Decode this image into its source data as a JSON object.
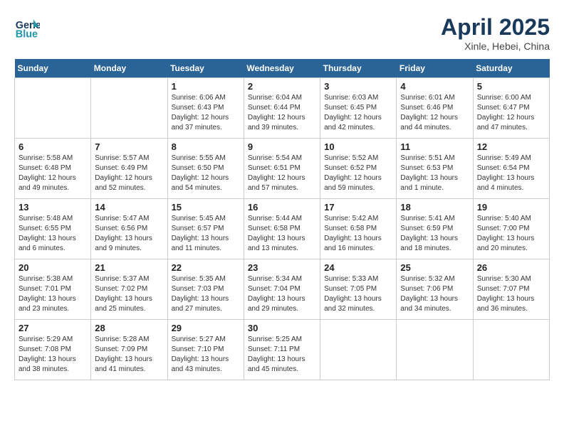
{
  "header": {
    "logo_line1": "General",
    "logo_line2": "Blue",
    "month_title": "April 2025",
    "subtitle": "Xinle, Hebei, China"
  },
  "weekdays": [
    "Sunday",
    "Monday",
    "Tuesday",
    "Wednesday",
    "Thursday",
    "Friday",
    "Saturday"
  ],
  "weeks": [
    [
      {
        "day": "",
        "sunrise": "",
        "sunset": "",
        "daylight": ""
      },
      {
        "day": "",
        "sunrise": "",
        "sunset": "",
        "daylight": ""
      },
      {
        "day": "1",
        "sunrise": "Sunrise: 6:06 AM",
        "sunset": "Sunset: 6:43 PM",
        "daylight": "Daylight: 12 hours and 37 minutes."
      },
      {
        "day": "2",
        "sunrise": "Sunrise: 6:04 AM",
        "sunset": "Sunset: 6:44 PM",
        "daylight": "Daylight: 12 hours and 39 minutes."
      },
      {
        "day": "3",
        "sunrise": "Sunrise: 6:03 AM",
        "sunset": "Sunset: 6:45 PM",
        "daylight": "Daylight: 12 hours and 42 minutes."
      },
      {
        "day": "4",
        "sunrise": "Sunrise: 6:01 AM",
        "sunset": "Sunset: 6:46 PM",
        "daylight": "Daylight: 12 hours and 44 minutes."
      },
      {
        "day": "5",
        "sunrise": "Sunrise: 6:00 AM",
        "sunset": "Sunset: 6:47 PM",
        "daylight": "Daylight: 12 hours and 47 minutes."
      }
    ],
    [
      {
        "day": "6",
        "sunrise": "Sunrise: 5:58 AM",
        "sunset": "Sunset: 6:48 PM",
        "daylight": "Daylight: 12 hours and 49 minutes."
      },
      {
        "day": "7",
        "sunrise": "Sunrise: 5:57 AM",
        "sunset": "Sunset: 6:49 PM",
        "daylight": "Daylight: 12 hours and 52 minutes."
      },
      {
        "day": "8",
        "sunrise": "Sunrise: 5:55 AM",
        "sunset": "Sunset: 6:50 PM",
        "daylight": "Daylight: 12 hours and 54 minutes."
      },
      {
        "day": "9",
        "sunrise": "Sunrise: 5:54 AM",
        "sunset": "Sunset: 6:51 PM",
        "daylight": "Daylight: 12 hours and 57 minutes."
      },
      {
        "day": "10",
        "sunrise": "Sunrise: 5:52 AM",
        "sunset": "Sunset: 6:52 PM",
        "daylight": "Daylight: 12 hours and 59 minutes."
      },
      {
        "day": "11",
        "sunrise": "Sunrise: 5:51 AM",
        "sunset": "Sunset: 6:53 PM",
        "daylight": "Daylight: 13 hours and 1 minute."
      },
      {
        "day": "12",
        "sunrise": "Sunrise: 5:49 AM",
        "sunset": "Sunset: 6:54 PM",
        "daylight": "Daylight: 13 hours and 4 minutes."
      }
    ],
    [
      {
        "day": "13",
        "sunrise": "Sunrise: 5:48 AM",
        "sunset": "Sunset: 6:55 PM",
        "daylight": "Daylight: 13 hours and 6 minutes."
      },
      {
        "day": "14",
        "sunrise": "Sunrise: 5:47 AM",
        "sunset": "Sunset: 6:56 PM",
        "daylight": "Daylight: 13 hours and 9 minutes."
      },
      {
        "day": "15",
        "sunrise": "Sunrise: 5:45 AM",
        "sunset": "Sunset: 6:57 PM",
        "daylight": "Daylight: 13 hours and 11 minutes."
      },
      {
        "day": "16",
        "sunrise": "Sunrise: 5:44 AM",
        "sunset": "Sunset: 6:58 PM",
        "daylight": "Daylight: 13 hours and 13 minutes."
      },
      {
        "day": "17",
        "sunrise": "Sunrise: 5:42 AM",
        "sunset": "Sunset: 6:58 PM",
        "daylight": "Daylight: 13 hours and 16 minutes."
      },
      {
        "day": "18",
        "sunrise": "Sunrise: 5:41 AM",
        "sunset": "Sunset: 6:59 PM",
        "daylight": "Daylight: 13 hours and 18 minutes."
      },
      {
        "day": "19",
        "sunrise": "Sunrise: 5:40 AM",
        "sunset": "Sunset: 7:00 PM",
        "daylight": "Daylight: 13 hours and 20 minutes."
      }
    ],
    [
      {
        "day": "20",
        "sunrise": "Sunrise: 5:38 AM",
        "sunset": "Sunset: 7:01 PM",
        "daylight": "Daylight: 13 hours and 23 minutes."
      },
      {
        "day": "21",
        "sunrise": "Sunrise: 5:37 AM",
        "sunset": "Sunset: 7:02 PM",
        "daylight": "Daylight: 13 hours and 25 minutes."
      },
      {
        "day": "22",
        "sunrise": "Sunrise: 5:35 AM",
        "sunset": "Sunset: 7:03 PM",
        "daylight": "Daylight: 13 hours and 27 minutes."
      },
      {
        "day": "23",
        "sunrise": "Sunrise: 5:34 AM",
        "sunset": "Sunset: 7:04 PM",
        "daylight": "Daylight: 13 hours and 29 minutes."
      },
      {
        "day": "24",
        "sunrise": "Sunrise: 5:33 AM",
        "sunset": "Sunset: 7:05 PM",
        "daylight": "Daylight: 13 hours and 32 minutes."
      },
      {
        "day": "25",
        "sunrise": "Sunrise: 5:32 AM",
        "sunset": "Sunset: 7:06 PM",
        "daylight": "Daylight: 13 hours and 34 minutes."
      },
      {
        "day": "26",
        "sunrise": "Sunrise: 5:30 AM",
        "sunset": "Sunset: 7:07 PM",
        "daylight": "Daylight: 13 hours and 36 minutes."
      }
    ],
    [
      {
        "day": "27",
        "sunrise": "Sunrise: 5:29 AM",
        "sunset": "Sunset: 7:08 PM",
        "daylight": "Daylight: 13 hours and 38 minutes."
      },
      {
        "day": "28",
        "sunrise": "Sunrise: 5:28 AM",
        "sunset": "Sunset: 7:09 PM",
        "daylight": "Daylight: 13 hours and 41 minutes."
      },
      {
        "day": "29",
        "sunrise": "Sunrise: 5:27 AM",
        "sunset": "Sunset: 7:10 PM",
        "daylight": "Daylight: 13 hours and 43 minutes."
      },
      {
        "day": "30",
        "sunrise": "Sunrise: 5:25 AM",
        "sunset": "Sunset: 7:11 PM",
        "daylight": "Daylight: 13 hours and 45 minutes."
      },
      {
        "day": "",
        "sunrise": "",
        "sunset": "",
        "daylight": ""
      },
      {
        "day": "",
        "sunrise": "",
        "sunset": "",
        "daylight": ""
      },
      {
        "day": "",
        "sunrise": "",
        "sunset": "",
        "daylight": ""
      }
    ]
  ]
}
